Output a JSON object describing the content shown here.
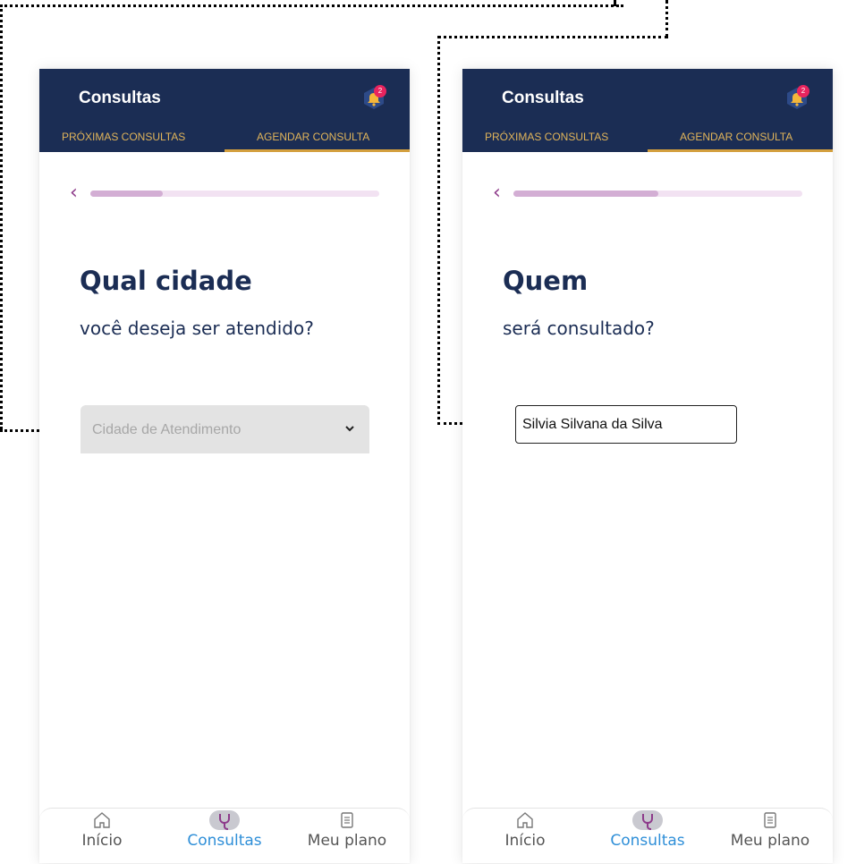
{
  "screens": [
    {
      "appbar": {
        "title": "Consultas",
        "notification_count": "2"
      },
      "tabs": [
        "PRÓXIMAS CONSULTAS",
        "AGENDAR CONSULTA"
      ],
      "progress": 0.25,
      "question": {
        "title": "Qual cidade",
        "subtitle": "você deseja ser atendido?"
      },
      "city_select": {
        "placeholder": "Cidade de Atendimento"
      },
      "nav": [
        {
          "label": "Início",
          "icon": "home-icon"
        },
        {
          "label": "Consultas",
          "icon": "stethoscope-icon"
        },
        {
          "label": "Meu plano",
          "icon": "document-icon"
        }
      ]
    },
    {
      "appbar": {
        "title": "Consultas",
        "notification_count": "2"
      },
      "tabs": [
        "PRÓXIMAS CONSULTAS",
        "AGENDAR CONSULTA"
      ],
      "progress": 0.5,
      "question": {
        "title": "Quem",
        "subtitle": "será consultado?"
      },
      "patient_field": {
        "value": "Silvia Silvana da Silva"
      },
      "nav": [
        {
          "label": "Início",
          "icon": "home-icon"
        },
        {
          "label": "Consultas",
          "icon": "stethoscope-icon"
        },
        {
          "label": "Meu plano",
          "icon": "document-icon"
        }
      ]
    }
  ],
  "colors": {
    "appbar": "#1b2d54",
    "tab_text": "#e0b45a",
    "tab_underline": "#d4a03e",
    "heading": "#1b2d54",
    "progress_fill": "#d3aed4",
    "progress_track": "#f2e2f2",
    "nav_active": "#2f8fd8",
    "connector_navy": "#3a4878",
    "connector_gold": "#c39a3c"
  }
}
